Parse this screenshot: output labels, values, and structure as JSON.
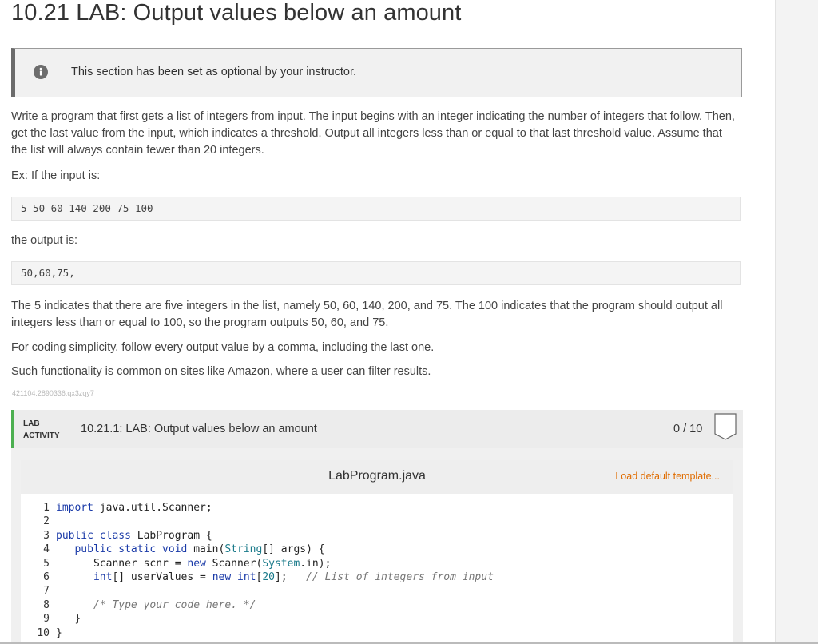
{
  "page": {
    "title": "10.21 LAB: Output values below an amount",
    "notice": {
      "icon": "info-icon",
      "text": "This section has been set as optional by your instructor."
    },
    "description": "Write a program that first gets a list of integers from input. The input begins with an integer indicating the number of integers that follow. Then, get the last value from the input, which indicates a threshold. Output all integers less than or equal to that last threshold value. Assume that the list will always contain fewer than 20 integers.",
    "example_input_label": "Ex: If the input is:",
    "example_input": "5 50 60 140 200 75 100",
    "example_output_label": "the output is:",
    "example_output": "50,60,75,",
    "explanation": "The 5 indicates that there are five integers in the list, namely 50, 60, 140, 200, and 75. The 100 indicates that the program should output all integers less than or equal to 100, so the program outputs 50, 60, and 75.",
    "note_comma": "For coding simplicity, follow every output value by a comma, including the last one.",
    "note_functionality": "Such functionality is common on sites like Amazon, where a user can filter results.",
    "code_id": "421104.2890336.qx3zqy7"
  },
  "lab": {
    "type_line1": "LAB",
    "type_line2": "ACTIVITY",
    "title": "10.21.1: LAB: Output values below an amount",
    "score": "0 / 10",
    "accent_color": "#4caf50",
    "file_name": "LabProgram.java",
    "load_template_label": "Load default template...",
    "code_lines": [
      {
        "num": "1",
        "code": "import java.util.Scanner;"
      },
      {
        "num": "2",
        "code": ""
      },
      {
        "num": "3",
        "code": "public class LabProgram {"
      },
      {
        "num": "4",
        "code": "   public static void main(String[] args) {"
      },
      {
        "num": "5",
        "code": "      Scanner scnr = new Scanner(System.in);"
      },
      {
        "num": "6",
        "code": "      int[] userValues = new int[20];   // List of integers from input"
      },
      {
        "num": "7",
        "code": ""
      },
      {
        "num": "8",
        "code": "      /* Type your code here. */"
      },
      {
        "num": "9",
        "code": "   }"
      },
      {
        "num": "10",
        "code": "}"
      }
    ]
  }
}
